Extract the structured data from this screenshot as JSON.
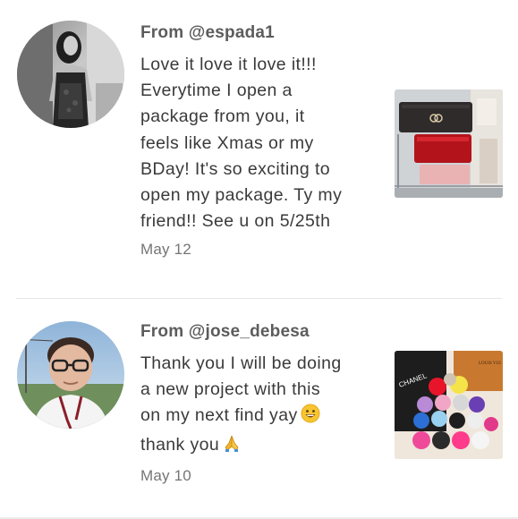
{
  "reviews": [
    {
      "from": "From @espada1",
      "text": "Love it love it love it!!!\nEverytime I open a\npackage from you, it\nfeels like Xmas or my\nBDay! It's so exciting to\nopen my package. Ty my\nfriend!! See u on 5/25th",
      "date": "May 12",
      "avatar_icon": "user-avatar-photo",
      "thumbnail_icon": "chanel-wallets-photo"
    },
    {
      "from": "From @jose_debesa",
      "text_main": "Thank you I will be doing\na new project with this\non my next find yay",
      "text_tail": "thank you",
      "date": "May 10",
      "avatar_icon": "user-avatar-photo",
      "thumbnail_icon": "pompom-keychains-photo",
      "thumbnail_labels": {
        "brand_left": "CHANEL",
        "brand_right": "LOUIS VUI"
      }
    }
  ],
  "colors": {
    "username": "#5c5c5c",
    "body_text": "#3a3a3a",
    "date": "#757575",
    "divider": "#e6e6e6"
  }
}
